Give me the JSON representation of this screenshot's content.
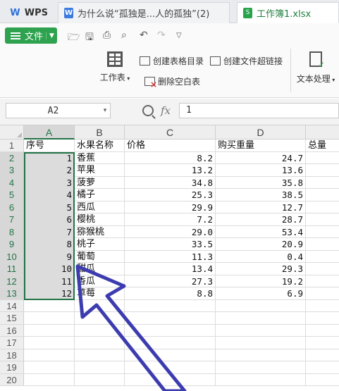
{
  "tabs": {
    "wps_label": "WPS",
    "doc_label": "为什么说“孤独是...人的孤独”(2)",
    "xls_label": "工作簿1.xlsx"
  },
  "ribbon": {
    "file_label": "文件",
    "worksheet_label": "工作表",
    "create_toc_label": "创建表格目录",
    "create_link_label": "创建文件超链接",
    "delete_blank_label": "删除空白表",
    "text_proc_label": "文本处理"
  },
  "formula_bar": {
    "name_box": "A2",
    "fx": "fx",
    "value": "1"
  },
  "columns": [
    "A",
    "B",
    "C",
    "D"
  ],
  "rows": [
    "1",
    "2",
    "3",
    "4",
    "5",
    "6",
    "7",
    "8",
    "9",
    "10",
    "11",
    "12",
    "13",
    "14",
    "15",
    "16",
    "17",
    "18",
    "19",
    "20"
  ],
  "headers": [
    "序号",
    "水果名称",
    "价格",
    "购买重量",
    "总量"
  ],
  "table": [
    {
      "idx": "1",
      "name": "香蕉",
      "price": "8.2",
      "weight": "24.7"
    },
    {
      "idx": "2",
      "name": "苹果",
      "price": "13.2",
      "weight": "13.6"
    },
    {
      "idx": "3",
      "name": "菠萝",
      "price": "34.8",
      "weight": "35.8"
    },
    {
      "idx": "4",
      "name": "橘子",
      "price": "25.3",
      "weight": "38.5"
    },
    {
      "idx": "5",
      "name": "西瓜",
      "price": "29.9",
      "weight": "12.7"
    },
    {
      "idx": "6",
      "name": "樱桃",
      "price": "7.2",
      "weight": "28.7"
    },
    {
      "idx": "7",
      "name": "猕猴桃",
      "price": "29.0",
      "weight": "53.4"
    },
    {
      "idx": "8",
      "name": "桃子",
      "price": "33.5",
      "weight": "20.9"
    },
    {
      "idx": "9",
      "name": "葡萄",
      "price": "11.3",
      "weight": "0.4"
    },
    {
      "idx": "10",
      "name": "甜瓜",
      "price": "13.4",
      "weight": "29.3"
    },
    {
      "idx": "11",
      "name": "香瓜",
      "price": "27.3",
      "weight": "19.2"
    },
    {
      "idx": "12",
      "name": "草莓",
      "price": "8.8",
      "weight": "6.9"
    }
  ],
  "icons": {
    "save": "save-icon",
    "print": "print-icon",
    "preview": "print-preview-icon",
    "undo": "undo-icon",
    "redo": "redo-icon",
    "more": "chevron-down-icon",
    "open": "folder-icon"
  },
  "colors": {
    "accent": "#2ea24e",
    "selection": "#217346",
    "annotation_arrow": "#3c3cb0"
  }
}
